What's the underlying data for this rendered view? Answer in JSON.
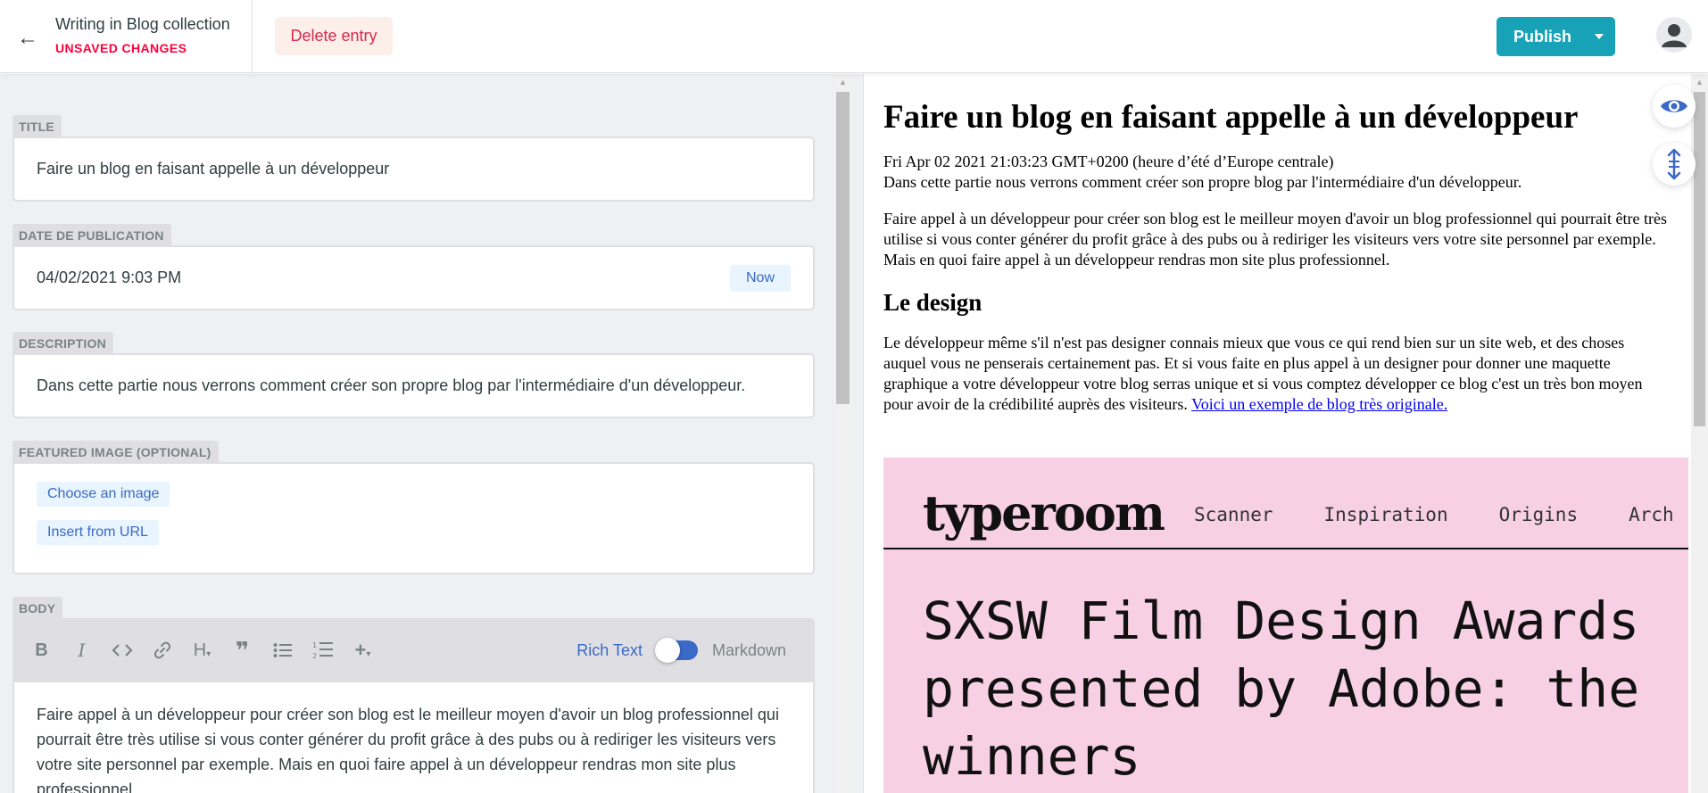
{
  "topbar": {
    "back_icon": "arrow-left-icon",
    "collection_title": "Writing in Blog collection",
    "unsaved_status": "UNSAVED CHANGES",
    "delete_label": "Delete entry",
    "publish_label": "Publish",
    "avatar_icon": "user-avatar-icon"
  },
  "fields": {
    "title": {
      "label": "TITLE",
      "value": "Faire un blog en faisant appelle à un développeur"
    },
    "date": {
      "label": "DATE DE PUBLICATION",
      "value": "04/02/2021 9:03 PM",
      "now_label": "Now"
    },
    "description": {
      "label": "DESCRIPTION",
      "value": "Dans cette partie nous verrons comment créer son propre blog par l'intermédiaire d'un développeur."
    },
    "image": {
      "label": "FEATURED IMAGE (OPTIONAL)",
      "choose_label": "Choose an image",
      "url_label": "Insert from URL"
    },
    "body": {
      "label": "BODY",
      "toolbar": {
        "bold": "B",
        "italic": "I",
        "code": "<>",
        "heading": "H",
        "quote": "❞",
        "rich_text_label": "Rich Text",
        "markdown_label": "Markdown",
        "rich_text_on": true
      },
      "text": "Faire appel à un développeur pour créer son blog est le meilleur moyen d'avoir un blog professionnel qui pourrait être très utilise si vous conter générer du profit grâce à des pubs ou à rediriger les visiteurs vers votre site personnel par exemple. Mais en quoi faire appel à un développeur rendras mon site plus professionnel."
    }
  },
  "preview": {
    "title": "Faire un blog en faisant appelle à un développeur",
    "date": "Fri Apr 02 2021 21:03:23 GMT+0200 (heure d’été d’Europe centrale)",
    "description": "Dans cette partie nous verrons comment créer son propre blog par l'intermédiaire d'un développeur.",
    "para1": "Faire appel à un développeur pour créer son blog est le meilleur moyen d'avoir un blog professionnel qui pourrait être très utilise si vous conter générer du profit grâce à des pubs ou à rediriger les visiteurs vers votre site personnel par exemple. Mais en quoi faire appel à un développeur rendras mon site plus professionnel.",
    "h2": "Le design",
    "para2": "Le développeur même s'il n'est pas designer connais mieux que vous ce qui rend bien sur un site web, et des choses auquel vous ne penserais certainement pas. Et si vous faite en plus appel à un designer pour donner une maquette graphique a votre développeur votre blog serras unique et si vous comptez développer ce blog c'est un très bon moyen pour avoir de la crédibilité auprès des visiteurs.",
    "link": "Voici un exemple de blog très originale.",
    "embed": {
      "logo": "typeroom",
      "nav": [
        "Scanner",
        "Inspiration",
        "Origins",
        "Arch"
      ],
      "headline": [
        "SXSW Film Design Awards",
        "presented by Adobe: the",
        "winners"
      ],
      "background": "#f7d0e4"
    }
  },
  "floating": {
    "preview_icon": "eye-icon",
    "sync_scroll_icon": "sync-scroll-icon"
  },
  "colors": {
    "accent": "#3a69c7",
    "publish": "#17a2b8",
    "danger": "#ff003b"
  }
}
